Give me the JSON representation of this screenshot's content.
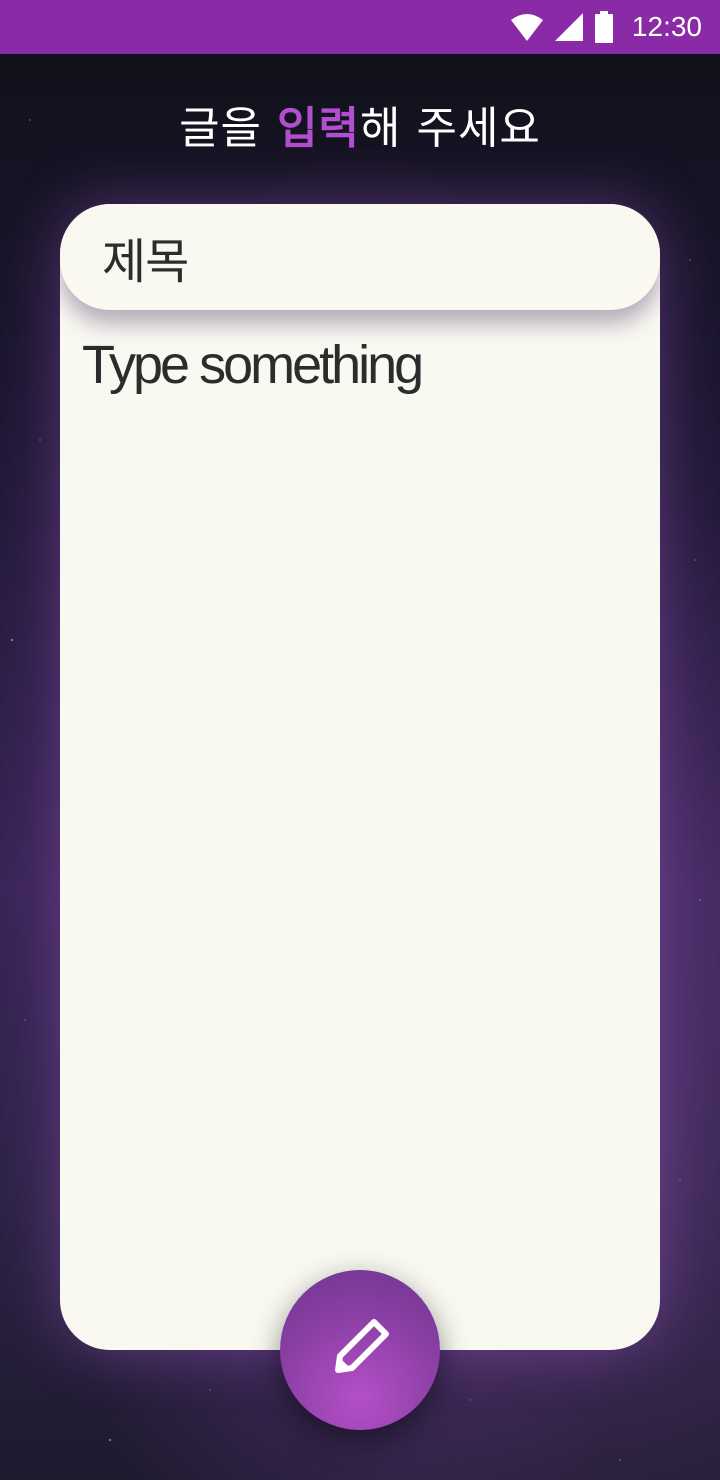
{
  "status_bar": {
    "time": "12:30",
    "icons": [
      "wifi-icon",
      "signal-icon",
      "battery-icon"
    ],
    "background": "#8b2aa6"
  },
  "headline": {
    "prefix": "글을 ",
    "accent": "입력",
    "suffix": "해 주세요",
    "accent_color": "#b14fcf"
  },
  "editor": {
    "title_placeholder": "제목",
    "body_placeholder": "Type something"
  },
  "fab": {
    "icon": "pencil-icon",
    "color": "#9c45b8"
  }
}
